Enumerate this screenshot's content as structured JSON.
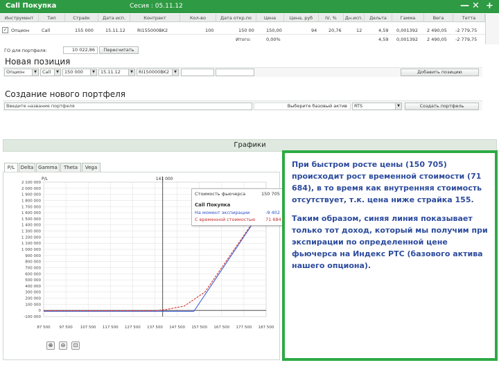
{
  "titlebar": {
    "title": "Call Покупка",
    "session": "Сесия : 05.11.12",
    "controls": [
      "—",
      "✕",
      "+"
    ]
  },
  "position_table": {
    "headers": [
      "Инструмент",
      "Тип",
      "Страйк",
      "Дата исп.",
      "Контракт",
      "Кол-во",
      "Дата откр.по",
      "Цена",
      "Цена, руб",
      "IV, %",
      "Дн.исп.",
      "Дельта",
      "Гамма",
      "Вега",
      "Тетта"
    ],
    "row": {
      "checked": true,
      "instrument": "Опцион",
      "type": "Call",
      "strike": "155 000",
      "expiry": "15.11.12",
      "contract": "RI155000BK2",
      "qty": "100",
      "open_price": "150 00",
      "price": "150,00",
      "price_rub": "94",
      "iv": "20,76",
      "days": "12",
      "delta": "4,59",
      "gamma": "0,001392",
      "vega": "2 490,05",
      "theta": "-2 779,75"
    },
    "totals": {
      "label": "Итого:",
      "value": "0,00%",
      "delta": "4,59",
      "gamma": "0,001392",
      "vega": "2 490,05",
      "theta": "-2 779,75"
    }
  },
  "go": {
    "label": "ГО для портфеля:",
    "value": "10 022,86",
    "recalc_button": "Пересчитать"
  },
  "new_position": {
    "title": "Новая позиция",
    "type_select": "Опцион",
    "kind_select": "Call",
    "strike_select": "150 000",
    "expiry_select": "15.11.12",
    "contract_select": "RI150000BK2",
    "add_button": "Добавить позицию"
  },
  "new_portfolio": {
    "title": "Создание нового портфеля",
    "name_placeholder": "Введите название портфеля",
    "base_label": "Выберите базовый актив",
    "base_select": "RTS",
    "create_button": "Создать портфель"
  },
  "charts": {
    "title": "Графики",
    "tabs": [
      "P/L",
      "Delta",
      "Gamma",
      "Theta",
      "Vega"
    ],
    "active_tab": "P/L",
    "series_label": "P/L",
    "vline_label": "141 000",
    "tooltip": {
      "line1_label": "Стоимость фьючерса",
      "line1_value": "150 705",
      "title": "Call Покупка",
      "line2_label": "На момент экспирации",
      "line2_value": "-9 402",
      "line3_label": "С временной стоимостью",
      "line3_value": "71 684"
    },
    "zoom_buttons": [
      "zoom-in",
      "zoom-out",
      "zoom-reset"
    ]
  },
  "chart_data": {
    "type": "line",
    "y_ticks": [
      "2 100 000",
      "2 000 000",
      "1 900 000",
      "1 800 000",
      "1 700 000",
      "1 600 000",
      "1 500 000",
      "1 400 000",
      "1 300 000",
      "1 200 000",
      "1 100 000",
      "1 000 000",
      "900 000",
      "800 000",
      "700 000",
      "600 000",
      "500 000",
      "400 000",
      "300 000",
      "200 000",
      "100 000",
      "0",
      "-100 000"
    ],
    "x_ticks": [
      "87 500",
      "97 500",
      "107 500",
      "117 500",
      "127 500",
      "137 500",
      "147 500",
      "157 500",
      "167 500",
      "177 500",
      "187 500"
    ],
    "ylim": [
      -100000,
      2100000
    ],
    "xlim": [
      87500,
      187500
    ],
    "grid": true,
    "series": [
      {
        "name": "На момент экспирации",
        "color": "#3b5bd6",
        "x": [
          87500,
          147500,
          155000,
          187500
        ],
        "y": [
          -15000,
          -15000,
          -15000,
          1750000
        ]
      },
      {
        "name": "С временной стоимостью",
        "color": "#d0342c",
        "x": [
          87500,
          137500,
          142500,
          150705,
          160000,
          187500
        ],
        "y": [
          -5000,
          -5000,
          15000,
          71684,
          300000,
          1760000
        ]
      }
    ]
  },
  "info_text": {
    "p1": "При быстром росте цены (150 705) происходит рост временной стоимости (71 684), в то время как внутренняя стоимость отсутствует, т.к. цена ниже страйка 155.",
    "p2": "Таким образом, синяя линия показывает только тот доход, который мы получим при экспирации по определенной цене фьючерса на Индекс РТС (базового актива нашего опциона)."
  }
}
